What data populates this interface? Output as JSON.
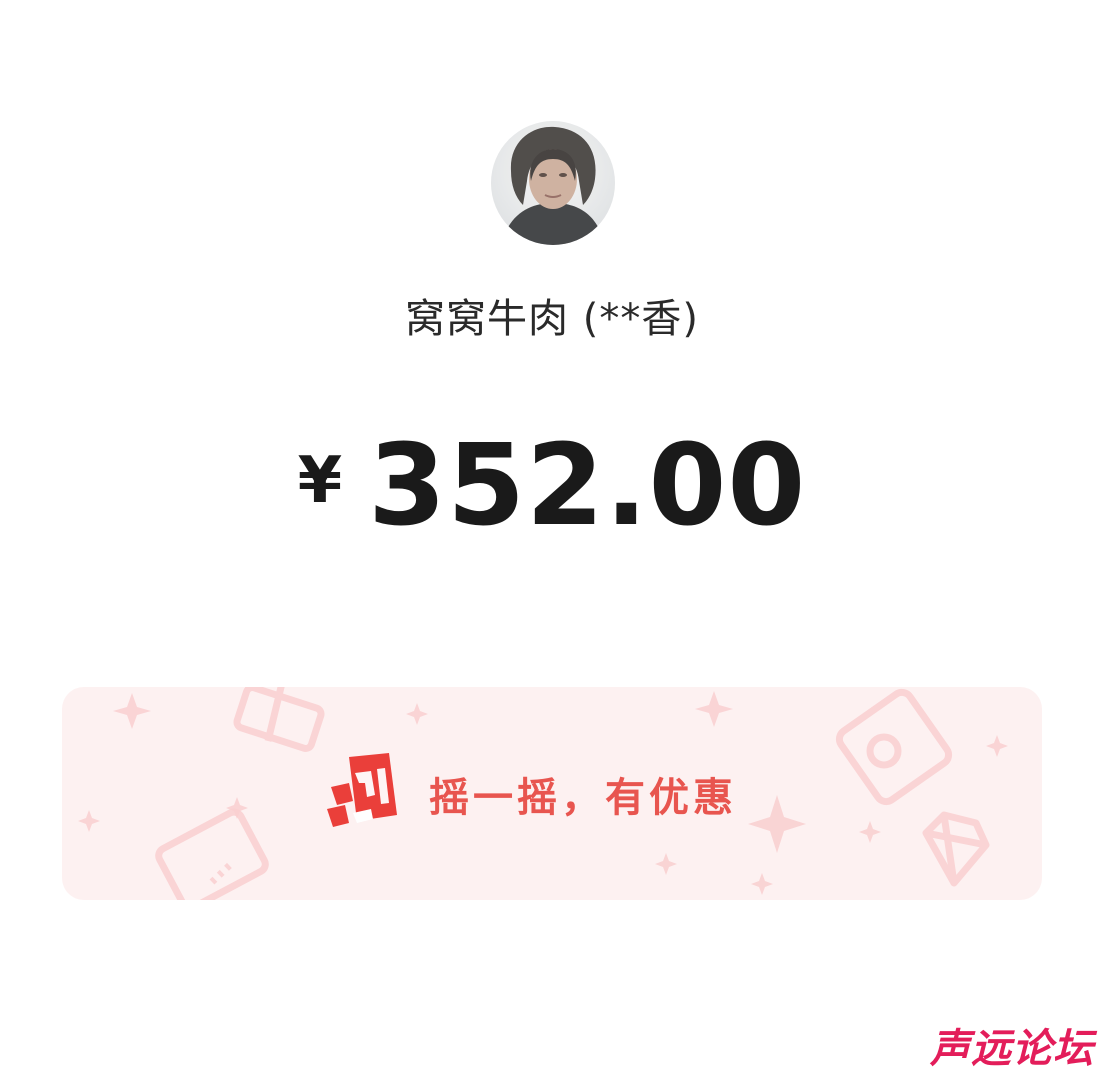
{
  "payee": {
    "name": "窝窝牛肉 (**香)",
    "avatar": "user-photo"
  },
  "payment": {
    "currency_symbol": "¥",
    "amount": "352.00"
  },
  "promo": {
    "label": "摇一摇，有优惠",
    "icon": "shake-phone-icon",
    "accent_color": "#e8554f",
    "background_color": "#fdf1f1"
  },
  "watermark": {
    "text": "声远论坛",
    "color": "#e31d5a"
  }
}
